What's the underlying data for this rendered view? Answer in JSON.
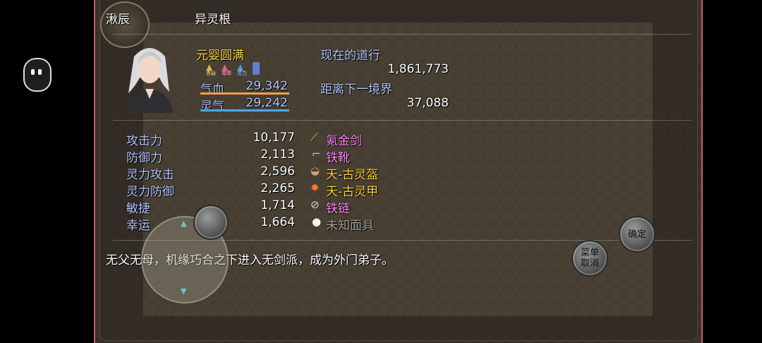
{
  "header": {
    "name": "湫辰",
    "root_type": "异灵根"
  },
  "profile": {
    "realm": "元婴圆满",
    "status_icons": [
      {
        "icon": "status-icon-1",
        "label": "赤焱"
      },
      {
        "icon": "status-icon-2",
        "label": "毒瘴"
      },
      {
        "icon": "status-icon-3",
        "label": "灵力"
      }
    ],
    "hp_label": "气血",
    "hp_value": "29,342",
    "hp_ratio": 1.0,
    "mp_label": "灵气",
    "mp_value": "29,242",
    "mp_ratio": 1.0,
    "dao_label": "现在的道行",
    "dao_value": "1,861,773",
    "next_label": "距离下一境界",
    "next_value": "37,088"
  },
  "stats": [
    {
      "label": "攻击力",
      "value": "10,177",
      "equip": "氪金剑",
      "equip_color": "#ff8cf4",
      "icon": "sword-icon"
    },
    {
      "label": "防御力",
      "value": "2,113",
      "equip": "铁靴",
      "equip_color": "#ff8cf4",
      "icon": "boots-icon"
    },
    {
      "label": "灵力攻击",
      "value": "2,596",
      "equip": "天-古灵盔",
      "equip_color": "#ffd23c",
      "icon": "helmet-icon"
    },
    {
      "label": "灵力防御",
      "value": "2,265",
      "equip": "天-古灵甲",
      "equip_color": "#ffd23c",
      "icon": "armor-icon"
    },
    {
      "label": "敏捷",
      "value": "1,714",
      "equip": "铁链",
      "equip_color": "#ff8cf4",
      "icon": "chain-icon"
    },
    {
      "label": "幸运",
      "value": "1,664",
      "equip": "未知面具",
      "equip_color": "#a7a39c",
      "icon": "mask-icon"
    }
  ],
  "description": "无父无母，机缘巧合之下进入无剑派，成为外门弟子。",
  "controls": {
    "confirm": "确定",
    "menu_line1": "菜单",
    "menu_line2": "取消"
  },
  "colors": {
    "label_blue": "#b6c7ff",
    "realm_gold": "#ffd54a",
    "hp_bar": "#f0a04b",
    "mp_bar": "#4aa8ff",
    "frame": "#c45a63"
  }
}
